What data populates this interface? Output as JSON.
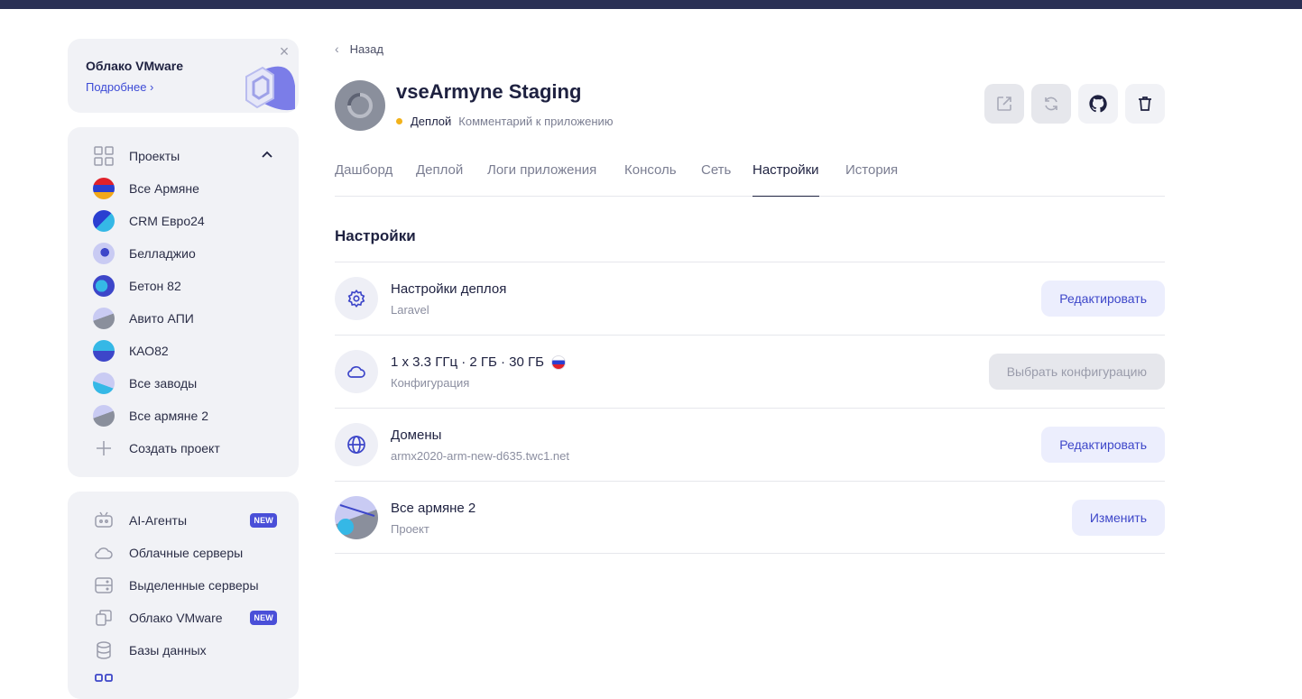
{
  "promo": {
    "title": "Облако VMware",
    "link": "Подробнее"
  },
  "projects": {
    "header": "Проекты",
    "items": [
      {
        "label": "Все Армяне"
      },
      {
        "label": "CRM Евро24"
      },
      {
        "label": "Белладжио"
      },
      {
        "label": "Бетон 82"
      },
      {
        "label": "Авито АПИ"
      },
      {
        "label": "КАО82"
      },
      {
        "label": "Все заводы"
      },
      {
        "label": "Все армяне 2"
      }
    ],
    "create": "Создать проект"
  },
  "services": {
    "items": [
      {
        "label": "AI-Агенты",
        "badge": "NEW"
      },
      {
        "label": "Облачные серверы"
      },
      {
        "label": "Выделенные серверы"
      },
      {
        "label": "Облако VMware",
        "badge": "NEW"
      },
      {
        "label": "Базы данных"
      }
    ]
  },
  "header": {
    "back": "Назад",
    "title": "vseArmyne Staging",
    "status": "Деплой",
    "comment": "Комментарий к приложению"
  },
  "tabs": [
    "Дашборд",
    "Деплой",
    "Логи приложения",
    "Консоль",
    "Сеть",
    "Настройки",
    "История"
  ],
  "active_tab": "Настройки",
  "settings": {
    "title": "Настройки",
    "rows": [
      {
        "title": "Настройки деплоя",
        "sub": "Laravel",
        "button": "Редактировать"
      },
      {
        "title": "1 x 3.3 ГГц · 2 ГБ · 30 ГБ",
        "sub": "Конфигурация",
        "button": "Выбрать конфигурацию"
      },
      {
        "title": "Домены",
        "sub": "armx2020-arm-new-d635.twc1.net",
        "button": "Редактировать"
      },
      {
        "title": "Все армяне 2",
        "sub": "Проект",
        "button": "Изменить"
      }
    ]
  },
  "colors": {
    "accent": "#4a4fd8",
    "topbar": "#2a3054",
    "status_dot": "#f2b21a"
  }
}
